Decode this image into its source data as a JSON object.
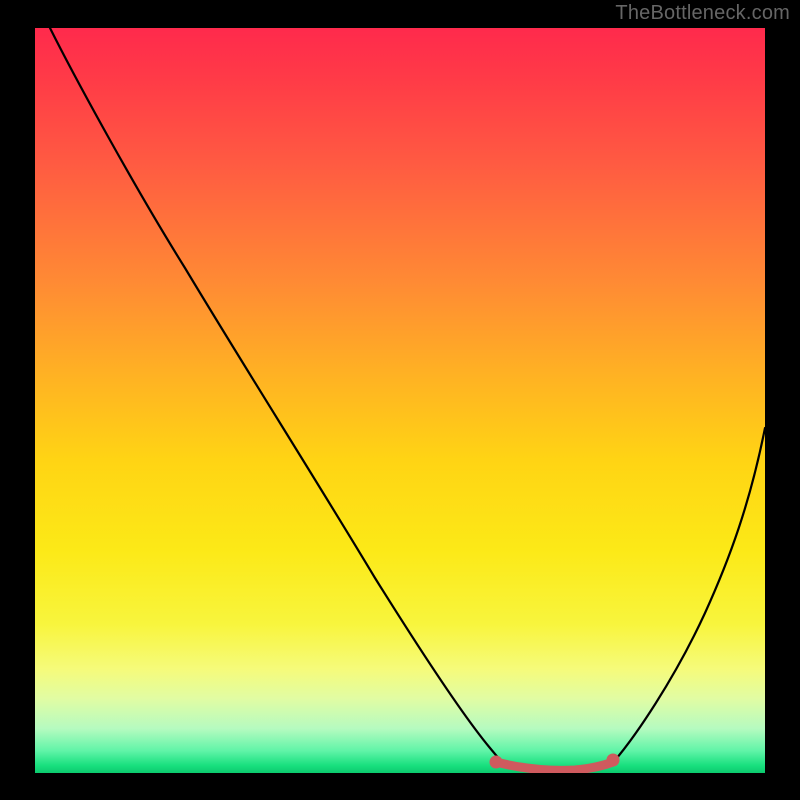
{
  "watermark": "TheBottleneck.com",
  "chart_data": {
    "type": "line",
    "title": "",
    "xlabel": "",
    "ylabel": "",
    "xlim": [
      0,
      100
    ],
    "ylim": [
      0,
      100
    ],
    "series": [
      {
        "name": "bottleneck-curve",
        "x": [
          2,
          10,
          20,
          30,
          40,
          50,
          58,
          62,
          68,
          72,
          76,
          80,
          86,
          92,
          100
        ],
        "values": [
          100,
          87,
          72,
          57,
          42,
          27,
          15,
          9,
          2,
          0,
          0,
          2,
          12,
          25,
          47
        ]
      }
    ],
    "markers": [
      {
        "name": "optimal-segment-start",
        "x": 62,
        "y": 2,
        "color": "#d4555a"
      },
      {
        "name": "optimal-segment-end",
        "x": 80,
        "y": 2,
        "color": "#d4555a"
      }
    ],
    "gradient_background": {
      "top": "#ff2a4c",
      "bottom": "#0cc96e",
      "meaning": "red=high-bottleneck, green=low-bottleneck"
    }
  }
}
